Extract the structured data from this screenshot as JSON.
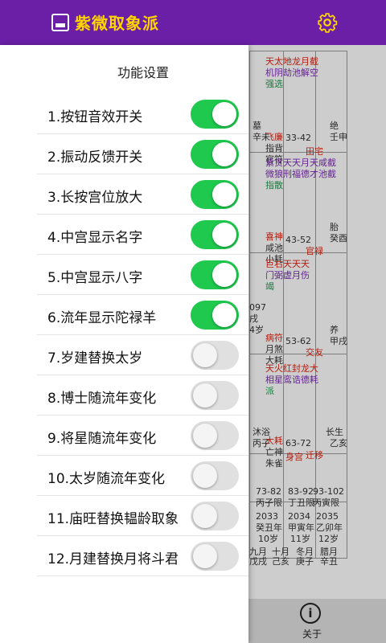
{
  "appbar": {
    "title": "紫微取象派",
    "bg_color": "#6a1fa6",
    "title_color": "#ffd400",
    "app_icon": "app-logo-icon",
    "settings_icon": "gear-icon"
  },
  "drawer": {
    "title": "功能设置",
    "items": [
      {
        "label": "1.按钮音效开关",
        "on": true
      },
      {
        "label": "2.振动反馈开关",
        "on": true
      },
      {
        "label": "3.长按宫位放大",
        "on": true
      },
      {
        "label": "4.中宫显示名字",
        "on": true
      },
      {
        "label": "5.中宫显示八字",
        "on": true
      },
      {
        "label": "6.流年显示陀禄羊",
        "on": true
      },
      {
        "label": "7.岁建替换太岁",
        "on": false
      },
      {
        "label": "8.博士随流年变化",
        "on": false
      },
      {
        "label": "9.将星随流年变化",
        "on": false
      },
      {
        "label": "10.太岁随流年变化",
        "on": false
      },
      {
        "label": "11.庙旺替换韫龄取象",
        "on": false
      },
      {
        "label": "12.月建替换月将斗君",
        "on": false
      }
    ],
    "switch_on_color": "#1ec94d"
  },
  "background": {
    "cells": [
      {
        "text": "天太地龙月截",
        "cls": "red"
      },
      {
        "text": "机阴劫池解空",
        "cls": "purple"
      },
      {
        "text": "强选",
        "cls": "green"
      },
      {
        "text": "墓",
        "cls": ""
      },
      {
        "text": "辛未",
        "cls": ""
      },
      {
        "text": "飞廉",
        "cls": "red"
      },
      {
        "text": "指背",
        "cls": ""
      },
      {
        "text": "官符",
        "cls": ""
      },
      {
        "text": "33-42",
        "cls": ""
      },
      {
        "text": "田宅",
        "cls": "red"
      },
      {
        "text": "绝",
        "cls": ""
      },
      {
        "text": "壬申",
        "cls": ""
      },
      {
        "text": "紫贪天天月天咸截",
        "cls": "purple"
      },
      {
        "text": "微狼刑福德才池截",
        "cls": "purple"
      },
      {
        "text": "指散",
        "cls": "green"
      },
      {
        "text": "喜神",
        "cls": "red"
      },
      {
        "text": "咸池",
        "cls": ""
      },
      {
        "text": "小耗",
        "cls": ""
      },
      {
        "text": "43-52",
        "cls": ""
      },
      {
        "text": "官禄",
        "cls": "red"
      },
      {
        "text": "胎",
        "cls": ""
      },
      {
        "text": "癸酉",
        "cls": ""
      },
      {
        "text": "巨右天天天",
        "cls": "red"
      },
      {
        "text": "门弼虚月伤",
        "cls": "purple"
      },
      {
        "text": "竭",
        "cls": "green"
      },
      {
        "text": "097",
        "cls": ""
      },
      {
        "text": "戌",
        "cls": ""
      },
      {
        "text": "4岁",
        "cls": ""
      },
      {
        "text": "病符",
        "cls": "red"
      },
      {
        "text": "月煞",
        "cls": ""
      },
      {
        "text": "大耗",
        "cls": ""
      },
      {
        "text": "53-62",
        "cls": ""
      },
      {
        "text": "交友",
        "cls": "red"
      },
      {
        "text": "养",
        "cls": ""
      },
      {
        "text": "甲戌",
        "cls": ""
      },
      {
        "text": "天火红封龙大",
        "cls": "red"
      },
      {
        "text": "相星鸾诰德耗",
        "cls": "purple"
      },
      {
        "text": "派",
        "cls": "green"
      },
      {
        "text": "沐浴",
        "cls": ""
      },
      {
        "text": "丙子",
        "cls": ""
      },
      {
        "text": "大耗",
        "cls": "red"
      },
      {
        "text": "亡神",
        "cls": ""
      },
      {
        "text": "朱雀",
        "cls": ""
      },
      {
        "text": "63-72",
        "cls": ""
      },
      {
        "text": "身宫",
        "cls": "red"
      },
      {
        "text": "迁移",
        "cls": "red"
      },
      {
        "text": "长生",
        "cls": ""
      },
      {
        "text": "乙亥",
        "cls": ""
      },
      {
        "text": "73-82",
        "cls": ""
      },
      {
        "text": "丙子限",
        "cls": ""
      },
      {
        "text": "83-92",
        "cls": ""
      },
      {
        "text": "丁丑限",
        "cls": ""
      },
      {
        "text": "93-102",
        "cls": ""
      },
      {
        "text": "丙寅限",
        "cls": ""
      },
      {
        "text": "2033",
        "cls": ""
      },
      {
        "text": "癸丑年",
        "cls": ""
      },
      {
        "text": "10岁",
        "cls": ""
      },
      {
        "text": "2034",
        "cls": ""
      },
      {
        "text": "甲寅年",
        "cls": ""
      },
      {
        "text": "11岁",
        "cls": ""
      },
      {
        "text": "2035",
        "cls": ""
      },
      {
        "text": "乙卯年",
        "cls": ""
      },
      {
        "text": "12岁",
        "cls": ""
      },
      {
        "text": "九月",
        "cls": ""
      },
      {
        "text": "戊戌",
        "cls": ""
      },
      {
        "text": "十月",
        "cls": ""
      },
      {
        "text": "己亥",
        "cls": ""
      },
      {
        "text": "冬月",
        "cls": ""
      },
      {
        "text": "庚子",
        "cls": ""
      },
      {
        "text": "腊月",
        "cls": ""
      },
      {
        "text": "辛丑",
        "cls": ""
      }
    ]
  },
  "bottombar": {
    "about_icon": "info-icon",
    "about_label": "关于"
  }
}
